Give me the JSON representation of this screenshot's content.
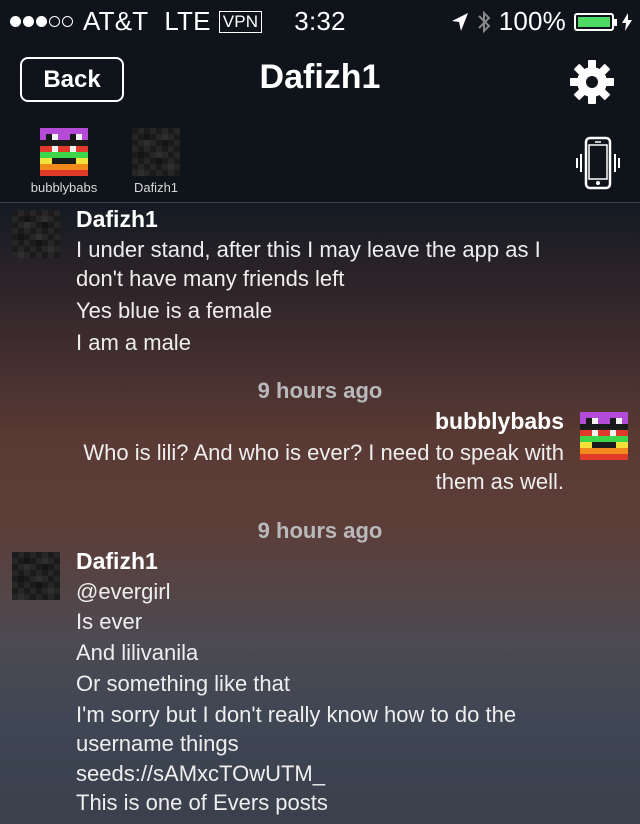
{
  "status": {
    "carrier": "AT&T",
    "network": "LTE",
    "vpn": "VPN",
    "time": "3:32",
    "battery": "100%",
    "battery_level": 1.0
  },
  "nav": {
    "back_label": "Back",
    "title": "Dafizh1"
  },
  "participants": [
    {
      "name": "bubblybabs"
    },
    {
      "name": "Dafizh1"
    }
  ],
  "messages": [
    {
      "sender": "Dafizh1",
      "lines": [
        "I under stand, after this I may leave the app as I",
        "don't have many friends left",
        "Yes blue is a female",
        "I am a male"
      ]
    },
    {
      "timestamp": "9 hours ago"
    },
    {
      "sender": "bubblybabs",
      "lines": [
        "Who is lili?  And who is ever?  I need to speak with",
        "them as well."
      ]
    },
    {
      "timestamp": "9 hours ago"
    },
    {
      "sender": "Dafizh1",
      "lines": [
        "@evergirl",
        "Is ever",
        "And lilivanila",
        "Or something like that",
        "I'm sorry but I don't really know how to do the",
        "username things",
        "seeds://sAMxcTOwUTM_",
        "This is one of Evers posts"
      ]
    }
  ],
  "colors": {
    "battery_green": "#4cd964",
    "bar_bg": "#0f141a",
    "timestamp": "#b9b9bc"
  },
  "icons": [
    "location-arrow-icon",
    "bluetooth-icon",
    "gear-icon",
    "vibrate-phone-icon"
  ]
}
